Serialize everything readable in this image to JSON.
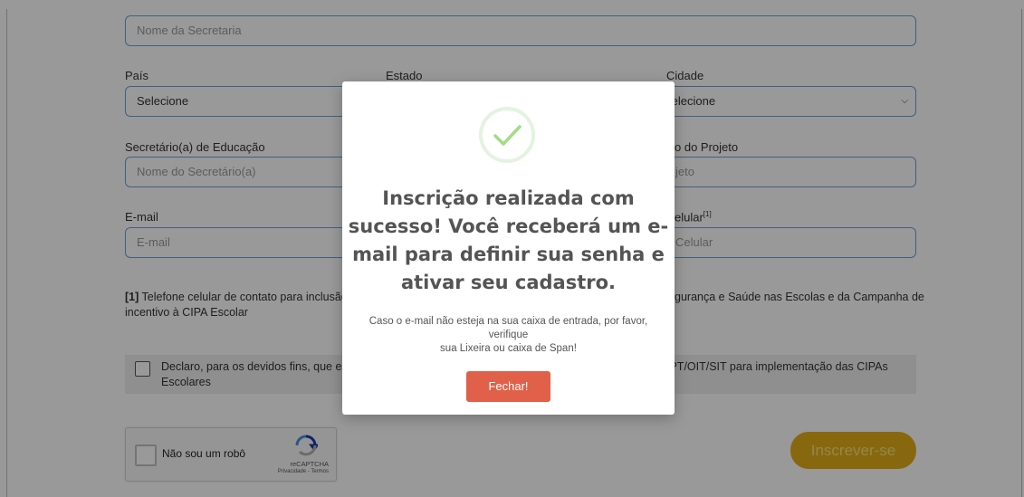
{
  "form": {
    "secretaria_placeholder": "Nome da Secretaria",
    "pais_label": "País",
    "pais_value": "Selecione",
    "estado_label": "Estado",
    "cidade_label": "Cidade",
    "cidade_value": "Selecione",
    "secretario_label": "Secretário(a) de Educação",
    "secretario_placeholder": "Nome do Secretário(a)",
    "projeto_label_fragment": "o do Projeto",
    "projeto_placeholder_fragment": "jeto",
    "email_label": "E-mail",
    "email_placeholder": "E-mail",
    "celular_label_fragment": "elular",
    "celular_sup": "[1]",
    "celular_placeholder_fragment": "Celular",
    "note_marker": "[1]",
    "note_left": " Telefone celular de contato para inclusão em g",
    "note_right": "gurança e Saúde nas Escolas e da Campanha de",
    "note_line2": "incentivo à CIPA Escolar",
    "declare_left_line1": "Declaro, para os devidos fins, que estou c",
    "declare_left_line2": "Escolares",
    "declare_right": "IPT/OIT/SIT para implementação das CIPAs",
    "recaptcha_label": "Não sou um robô",
    "recaptcha_brand": "reCAPTCHA",
    "recaptcha_links": "Privacidade - Termos",
    "submit_label": "Inscrever-se"
  },
  "modal": {
    "icon": "checkmark-icon",
    "title_line1": "Inscrição realizada com",
    "title_line2": "sucesso! Você receberá um e-",
    "title_line3": "mail para definir sua senha e",
    "title_line4": "ativar seu cadastro.",
    "message_line1": "Caso o e-mail não esteja na sua caixa de entrada, por favor, verifique",
    "message_line2": "sua Lixeira ou caixa de Span!",
    "button_label": "Fechar!"
  },
  "colors": {
    "accent_blue": "#6aa0d8",
    "success_green": "#a5dc86",
    "close_button": "#e0604a",
    "submit_button": "#e2ad19"
  }
}
